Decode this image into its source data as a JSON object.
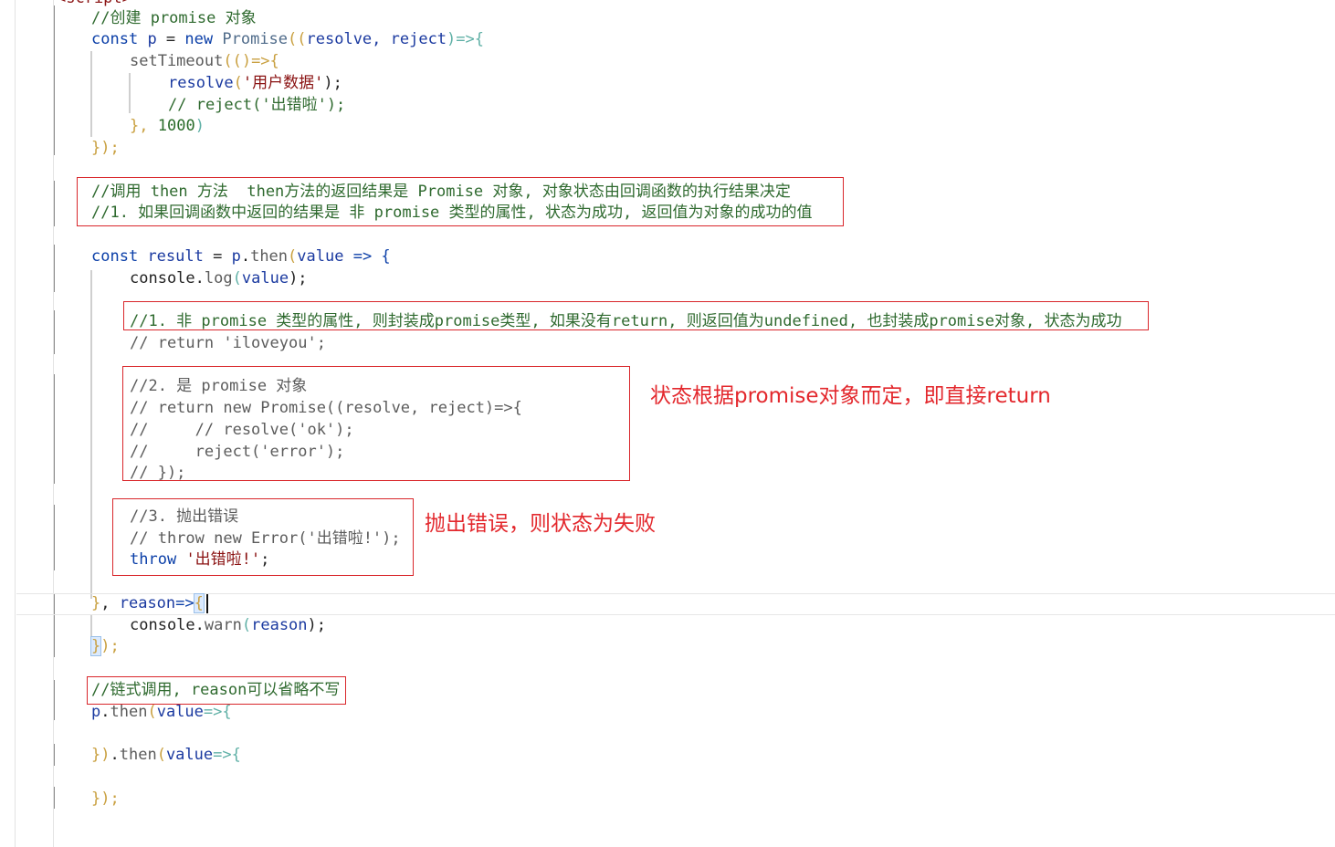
{
  "editor": {
    "top_partial": "<script>",
    "l1": "//创建 promise 对象",
    "l2": {
      "kw": "const",
      "var": "p",
      "eq": " = ",
      "new": "new",
      "cls": "Promise",
      "open": "((",
      "args": "resolve, reject",
      "close": ")=>{"
    },
    "l3": {
      "fn": "setTimeout",
      "open": "(()=>{"
    },
    "l4": {
      "fn": "resolve",
      "open": "(",
      "str": "'用户数据'",
      "close": ");"
    },
    "l5": "// reject('出错啦');",
    "l6": {
      "close": "},",
      "num": "1000",
      "end": ")"
    },
    "l7": "});",
    "c1": "//调用 then 方法  then方法的返回结果是 Promise 对象, 对象状态由回调函数的执行结果决定",
    "c2": "//1. 如果回调函数中返回的结果是 非 promise 类型的属性, 状态为成功, 返回值为对象的成功的值",
    "l8": {
      "kw": "const",
      "var": "result",
      "eq": " = ",
      "obj": "p",
      "dot": ".",
      "fn": "then",
      "open": "(",
      "arg": "value",
      "arrow": " => {"
    },
    "l9": {
      "obj": "console",
      "dot": ".",
      "fn": "log",
      "open": "(",
      "arg": "value",
      "close": ");"
    },
    "c3": "//1. 非 promise 类型的属性, 则封装成promise类型, 如果没有return, 则返回值为undefined, 也封装成promise对象, 状态为成功",
    "c4": "// return 'iloveyou';",
    "c5": "//2. 是 promise 对象",
    "c6": "// return new Promise((resolve, reject)=>{",
    "c7": "//     // resolve('ok');",
    "c8": "//     reject('error');",
    "c9": "// });",
    "c10": "//3. 抛出错误",
    "c11": "// throw new Error('出错啦!');",
    "l10": {
      "kw": "throw",
      "str": "'出错啦!'",
      "end": ";"
    },
    "l11": {
      "close": "}",
      "comma": ", ",
      "arg": "reason",
      "arrow": "=>",
      "open": "{"
    },
    "l12": {
      "obj": "console",
      "dot": ".",
      "fn": "warn",
      "open": "(",
      "arg": "reason",
      "close": ");"
    },
    "l13": {
      "br": "}",
      "close": ");"
    },
    "c12": "//链式调用, reason可以省略不写",
    "l14": {
      "obj": "p",
      "dot": ".",
      "fn": "then",
      "open": "(",
      "arg": "value",
      "arrow": "=>{"
    },
    "l15": {
      "close": "})",
      "dot": ".",
      "fn": "then",
      "open": "(",
      "arg": "value",
      "arrow": "=>{"
    },
    "l16": "});"
  },
  "annotations": {
    "note1": "状态根据promise对象而定，即直接return",
    "note2": "抛出错误，则状态为失败"
  },
  "colors": {
    "annotation_red": "#e3282d",
    "keyword_blue": "#0b3fa8",
    "comment_green": "#2f6a2f",
    "string_red": "#8a1212"
  }
}
